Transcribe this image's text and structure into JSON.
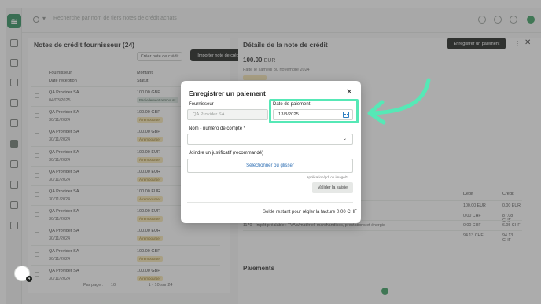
{
  "app": {
    "logo_text": "≋"
  },
  "topbar": {
    "search_placeholder": "Recherche par nom de tiers notes de crédit achats"
  },
  "left_panel": {
    "title": "Notes de crédit fournisseur (24)",
    "create_button": "Créer note de crédit",
    "import_button": "Importer note de crédit",
    "col_supplier": "Fournisseur",
    "col_date": "Date réception",
    "col_amount": "Montant",
    "col_status": "Statut",
    "rows": [
      {
        "name": "QA Provider SA",
        "date": "04/03/2025",
        "amount": "100.00 GBP",
        "status": "Partiellement rembours",
        "status_color": "green"
      },
      {
        "name": "QA Provider SA",
        "date": "30/11/2024",
        "amount": "100.00 GBP",
        "status": "À rembourser",
        "status_color": "yellow"
      },
      {
        "name": "QA Provider SA",
        "date": "30/11/2024",
        "amount": "100.00 GBP",
        "status": "À rembourser",
        "status_color": "yellow"
      },
      {
        "name": "QA Provider SA",
        "date": "30/11/2024",
        "amount": "100.00 EUR",
        "status": "À rembourser",
        "status_color": "yellow"
      },
      {
        "name": "QA Provider SA",
        "date": "30/11/2024",
        "amount": "100.00 EUR",
        "status": "À rembourser",
        "status_color": "yellow"
      },
      {
        "name": "QA Provider SA",
        "date": "30/11/2024",
        "amount": "100.00 EUR",
        "status": "À rembourser",
        "status_color": "yellow"
      },
      {
        "name": "QA Provider SA",
        "date": "30/11/2024",
        "amount": "100.00 EUR",
        "status": "À rembourser",
        "status_color": "yellow"
      },
      {
        "name": "QA Provider SA",
        "date": "30/11/2024",
        "amount": "100.00 EUR",
        "status": "À rembourser",
        "status_color": "yellow"
      },
      {
        "name": "QA Provider SA",
        "date": "30/11/2024",
        "amount": "100.00 GBP",
        "status": "À rembourser",
        "status_color": "yellow"
      },
      {
        "name": "QA Provider SA",
        "date": "30/11/2024",
        "amount": "100.00 GBP",
        "status": "À rembourser",
        "status_color": "yellow"
      }
    ],
    "pager_label": "Par page :",
    "pager_size": "10",
    "pager_range": "1 - 10 sur 24"
  },
  "right_panel": {
    "title": "Détails de la note de crédit",
    "save_payment_button": "Enregistrer un paiement",
    "amount": "100.00",
    "currency": "EUR",
    "date_text": "Faite le samedi 30 novembre 2024",
    "col_debit": "Débit",
    "col_credit": "Crédit",
    "lines": [
      {
        "text": "",
        "debit": "100.00 EUR",
        "credit": "0.00 EUR"
      },
      {
        "text": "...nnecomptabilisée",
        "debit": "0.00 CHF",
        "credit": "87.08 CHF"
      },
      {
        "text": "1170 - Impôt préalable : TVA s/matériel, marchandises, prestations et énergie",
        "debit": "0.00 CHF",
        "credit": "6.05 CHF"
      },
      {
        "text": "",
        "debit": "94.13 CHF",
        "credit": "94.13 CHF"
      }
    ],
    "payments_title": "Paiements"
  },
  "modal": {
    "title": "Enregistrer un paiement",
    "supplier_label": "Fournisseur",
    "supplier_value": "QA Provider SA",
    "date_label": "Date de paiement",
    "date_value": "13/3/2025",
    "account_label": "Nom - numéro de compte *",
    "account_value": "",
    "attachment_label": "Joindre un justificatif (recommandé)",
    "upload_button": "Sélectionner ou glisser",
    "file_hint": "application/pdf ou image/*",
    "validate_button": "Valider la saisie",
    "footer_text": "Solde restant pour régler la facture 0.00 CHF"
  },
  "widget": {
    "badge_count": "4"
  },
  "colors": {
    "highlight": "#56e8b6",
    "arrow": "#56e8b6",
    "primary_dark": "#1c1f1d",
    "brand_green": "#2f8f5e"
  }
}
